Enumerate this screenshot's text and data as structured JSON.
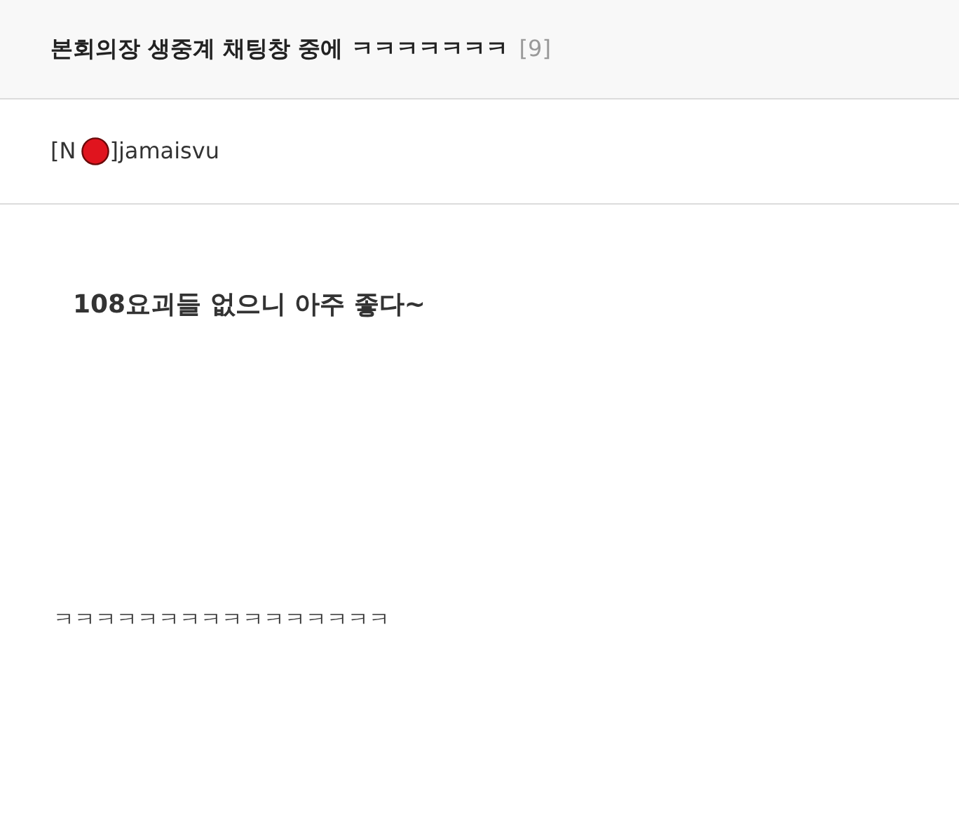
{
  "post": {
    "title": "본회의장 생중계 채팅창 중에 ㅋㅋㅋㅋㅋㅋㅋ",
    "comment_count": "[9]"
  },
  "author": {
    "prefix": "[N",
    "suffix": "]jamaisvu"
  },
  "body": [
    {
      "kind": "caption",
      "text": "108요괴들 없으니 아주 좋다~"
    },
    {
      "kind": "paragraph",
      "text": "ㅋㅋㅋㅋㅋㅋㅋㅋㅋㅋㅋㅋㅋㅋㅋㅋ"
    }
  ]
}
